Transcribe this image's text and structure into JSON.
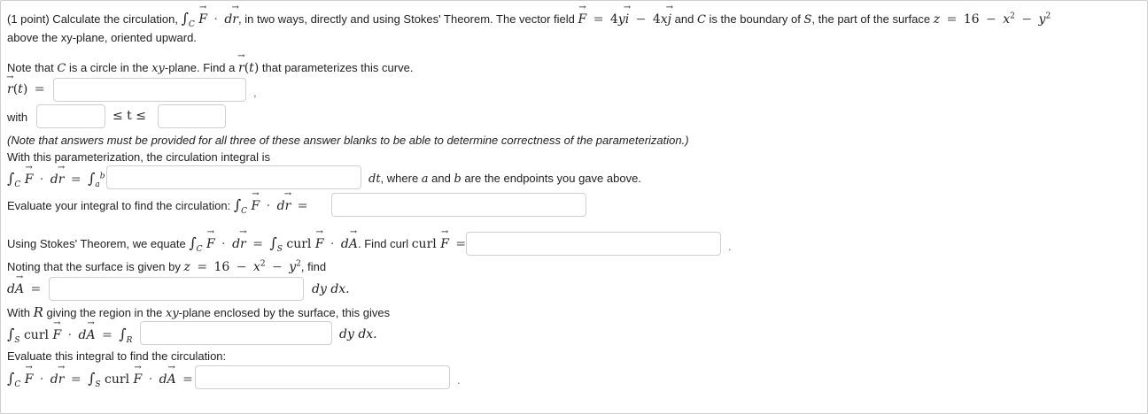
{
  "problem": {
    "intro_points": "(1 point) Calculate the circulation,",
    "intro_mid": ", in two ways, directly and using Stokes' Theorem. The vector field",
    "field_expr": "= 4yi − 4xj",
    "and_c": "and",
    "is_boundary": "is the boundary of",
    "surface_desc": ", the part of the surface",
    "surface_eq": "z = 16 − x² − y²",
    "line2": "above the xy-plane, oriented upward."
  },
  "part1": {
    "note_prefix": "Note that",
    "note_mid": "is a circle in the",
    "note_plane": "xy",
    "note_suffix": "-plane. Find a",
    "note_end": "that parameterizes this curve.",
    "r_label": "r(t) =",
    "r_value": "",
    "with_label": "with",
    "t_lower_value": "",
    "t_ineq": "≤ t ≤",
    "t_upper_value": "",
    "note_text": "(Note that answers must be provided for all three of these answer blanks to be able to determine correctness of the parameterization.)",
    "integral_intro": "With this parameterization, the circulation integral is",
    "integrand_value": "",
    "dt_suffix": "dt, where a and b are the endpoints you gave above.",
    "evaluate_label": "Evaluate your integral to find the circulation:",
    "circulation_value": ""
  },
  "part2": {
    "stokes_prefix": "Using Stokes' Theorem, we equate",
    "find_curl": ". Find curl",
    "curl_value": "",
    "surface_note_prefix": "Noting that the surface is given by",
    "surface_note_eq": "z = 16 − x² − y²",
    "surface_note_suffix": ", find",
    "dA_value": "",
    "dydx": "dy dx.",
    "region_prefix": "With",
    "region_R": "R",
    "region_mid": "giving the region in the",
    "region_suffix": "-plane enclosed by the surface, this gives",
    "region_integrand_value": "",
    "dydx2": "dy dx.",
    "evaluate_label": "Evaluate this integral to find the circulation:",
    "final_value": ""
  }
}
